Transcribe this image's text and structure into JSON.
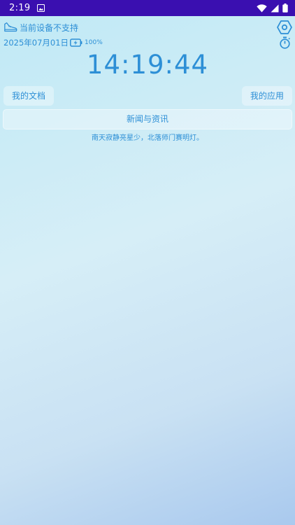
{
  "status_bar": {
    "time": "2:19",
    "notification_icon": "image-notification-icon",
    "icons": [
      "wifi-icon",
      "signal-icon",
      "battery-icon"
    ]
  },
  "header": {
    "step_icon": "shoe-icon",
    "step_text": "当前设备不支持",
    "date": "2025年07月01日",
    "charging_icon": "battery-charging-icon",
    "battery_percent": "100%",
    "settings_icon": "hexagon-settings-icon",
    "timer_icon": "stopwatch-icon"
  },
  "clock": {
    "time": "14:19:44"
  },
  "buttons": {
    "my_docs": "我的文档",
    "my_apps": "我的应用"
  },
  "news": {
    "title": "新闻与资讯"
  },
  "poem": {
    "text": "南天寂静亮星少，北落师门赛明灯。"
  },
  "colors": {
    "accent": "#2d8fd6",
    "status_bar": "#3a0fb0"
  }
}
